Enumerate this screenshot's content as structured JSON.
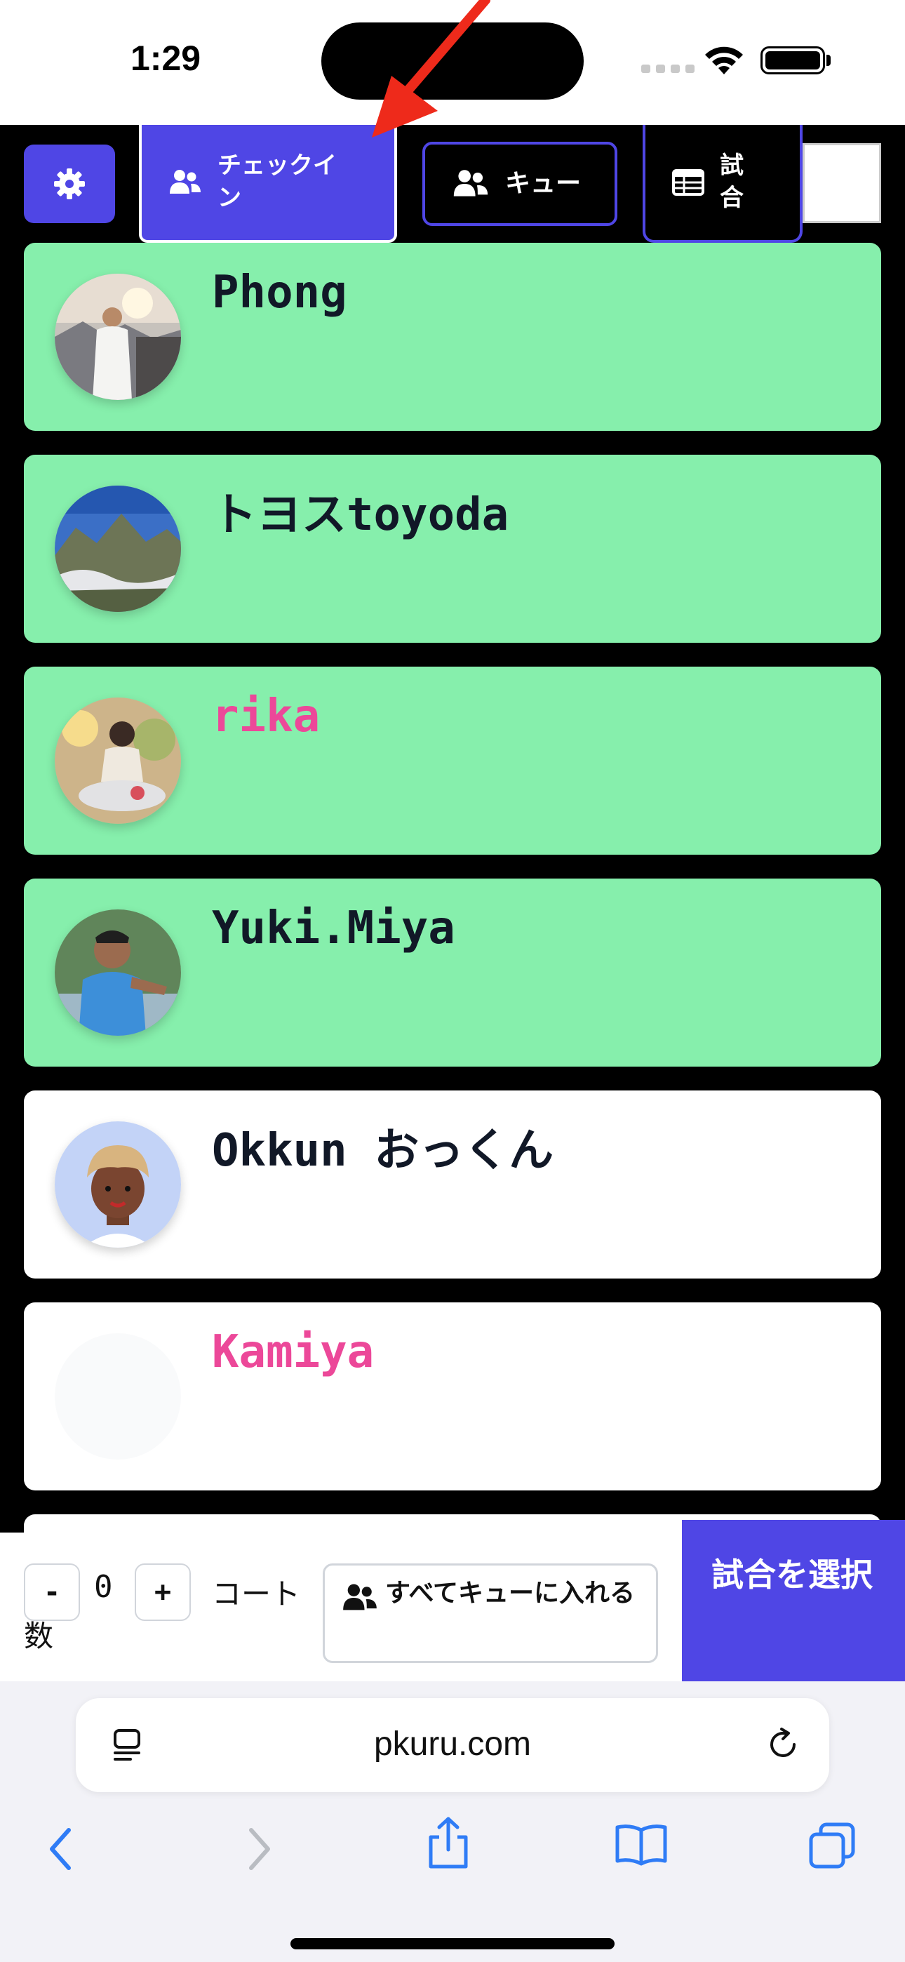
{
  "status_bar": {
    "time": "1:29"
  },
  "tabs": {
    "checkin": "チェックイ\nン",
    "queue": "キュー",
    "match": "試\n合"
  },
  "players": [
    {
      "name": "Phong",
      "checked_in": true,
      "name_color": "#111827"
    },
    {
      "name": "トヨスtoyoda",
      "checked_in": true,
      "name_color": "#111827"
    },
    {
      "name": "rika",
      "checked_in": true,
      "name_color": "#ec4899"
    },
    {
      "name": "Yuki.Miya",
      "checked_in": true,
      "name_color": "#111827"
    },
    {
      "name": "Okkun おっくん",
      "checked_in": false,
      "name_color": "#111827"
    },
    {
      "name": "Kamiya",
      "checked_in": false,
      "name_color": "#ec4899"
    }
  ],
  "controls": {
    "decrement": "-",
    "court_count": "0",
    "increment": "+",
    "court_label_part1": "コート",
    "court_label_part2": "数",
    "queue_all": "すべてキューに入れる",
    "select_match": "試合を選択"
  },
  "browser": {
    "url": "pkuru.com"
  },
  "colors": {
    "accent": "#4f46e5",
    "checked_in_card": "#86efac",
    "pink_name": "#ec4899",
    "annotation_arrow": "#ee2a1b"
  }
}
